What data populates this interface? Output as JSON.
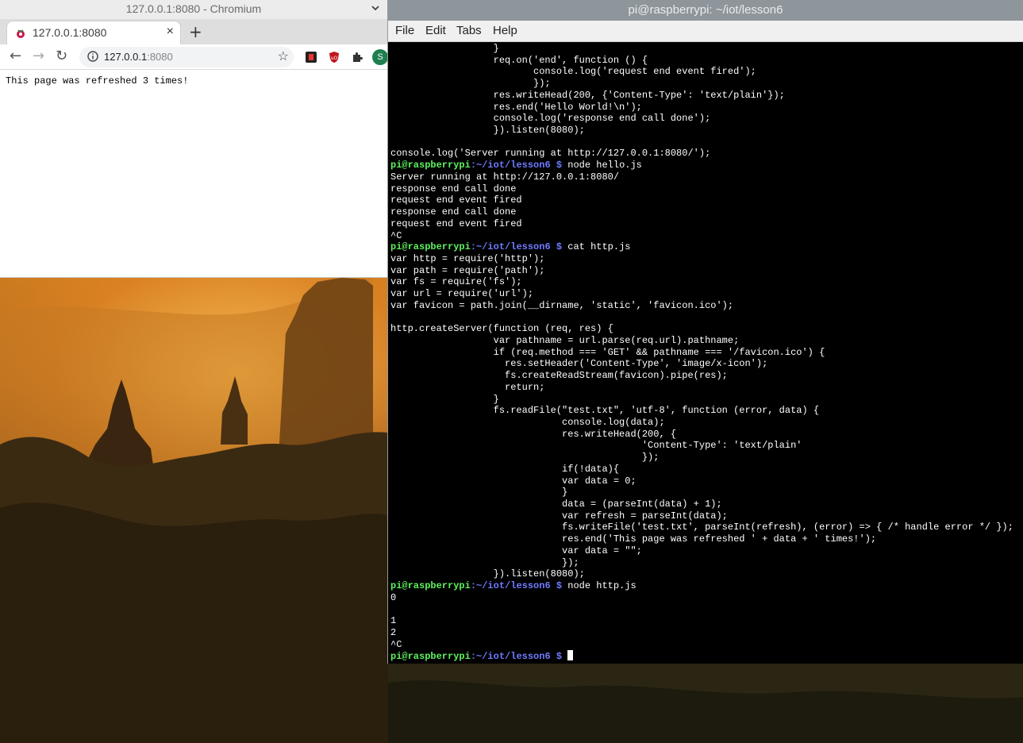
{
  "chromium": {
    "window_title": "127.0.0.1:8080 - Chromium",
    "tab_title": "127.0.0.1:8080",
    "tab_close": "×",
    "new_tab": "+",
    "url_host": "127.0.0.1",
    "url_port": ":8080",
    "profile_initial": "S",
    "page_text": "This page was refreshed 3 times!"
  },
  "terminal": {
    "window_title": "pi@raspberrypi: ~/iot/lesson6",
    "menu": [
      "File",
      "Edit",
      "Tabs",
      "Help"
    ],
    "prompt": {
      "user": "pi@raspberrypi",
      "sep": ":",
      "path": "~/iot/lesson6 $"
    },
    "lines": [
      {
        "text": "                  }"
      },
      {
        "text": "                  req.on('end', function () {"
      },
      {
        "text": "                         console.log('request end event fired');"
      },
      {
        "text": "                         });"
      },
      {
        "text": "                  res.writeHead(200, {'Content-Type': 'text/plain'});"
      },
      {
        "text": "                  res.end('Hello World!\\n');"
      },
      {
        "text": "                  console.log('response end call done');"
      },
      {
        "text": "                  }).listen(8080);"
      },
      {
        "text": ""
      },
      {
        "text": "console.log('Server running at http://127.0.0.1:8080/');"
      },
      {
        "prompt": true,
        "text": " node hello.js"
      },
      {
        "text": "Server running at http://127.0.0.1:8080/"
      },
      {
        "text": "response end call done"
      },
      {
        "text": "request end event fired"
      },
      {
        "text": "response end call done"
      },
      {
        "text": "request end event fired"
      },
      {
        "text": "^C"
      },
      {
        "prompt": true,
        "text": " cat http.js"
      },
      {
        "text": "var http = require('http');"
      },
      {
        "text": "var path = require('path');"
      },
      {
        "text": "var fs = require('fs');"
      },
      {
        "text": "var url = require('url');"
      },
      {
        "text": "var favicon = path.join(__dirname, 'static', 'favicon.ico');"
      },
      {
        "text": ""
      },
      {
        "text": "http.createServer(function (req, res) {"
      },
      {
        "text": "                  var pathname = url.parse(req.url).pathname;"
      },
      {
        "text": "                  if (req.method === 'GET' && pathname === '/favicon.ico') {"
      },
      {
        "text": "                    res.setHeader('Content-Type', 'image/x-icon');"
      },
      {
        "text": "                    fs.createReadStream(favicon).pipe(res);"
      },
      {
        "text": "                    return;"
      },
      {
        "text": "                  }"
      },
      {
        "text": "                  fs.readFile(\"test.txt\", 'utf-8', function (error, data) {"
      },
      {
        "text": "                              console.log(data);"
      },
      {
        "text": "                              res.writeHead(200, {"
      },
      {
        "text": "                                            'Content-Type': 'text/plain'"
      },
      {
        "text": "                                            });"
      },
      {
        "text": "                              if(!data){"
      },
      {
        "text": "                              var data = 0;"
      },
      {
        "text": "                              }"
      },
      {
        "text": "                              data = (parseInt(data) + 1);"
      },
      {
        "text": "                              var refresh = parseInt(data);"
      },
      {
        "text": "                              fs.writeFile('test.txt', parseInt(refresh), (error) => { /* handle error */ });"
      },
      {
        "text": "                              res.end('This page was refreshed ' + data + ' times!');"
      },
      {
        "text": "                              var data = \"\";"
      },
      {
        "text": "                              });"
      },
      {
        "text": "                  }).listen(8080);"
      },
      {
        "prompt": true,
        "text": " node http.js"
      },
      {
        "text": "0"
      },
      {
        "text": ""
      },
      {
        "text": "1"
      },
      {
        "text": "2"
      },
      {
        "text": "^C"
      },
      {
        "prompt": true,
        "text": " ",
        "cursor": true
      }
    ]
  }
}
